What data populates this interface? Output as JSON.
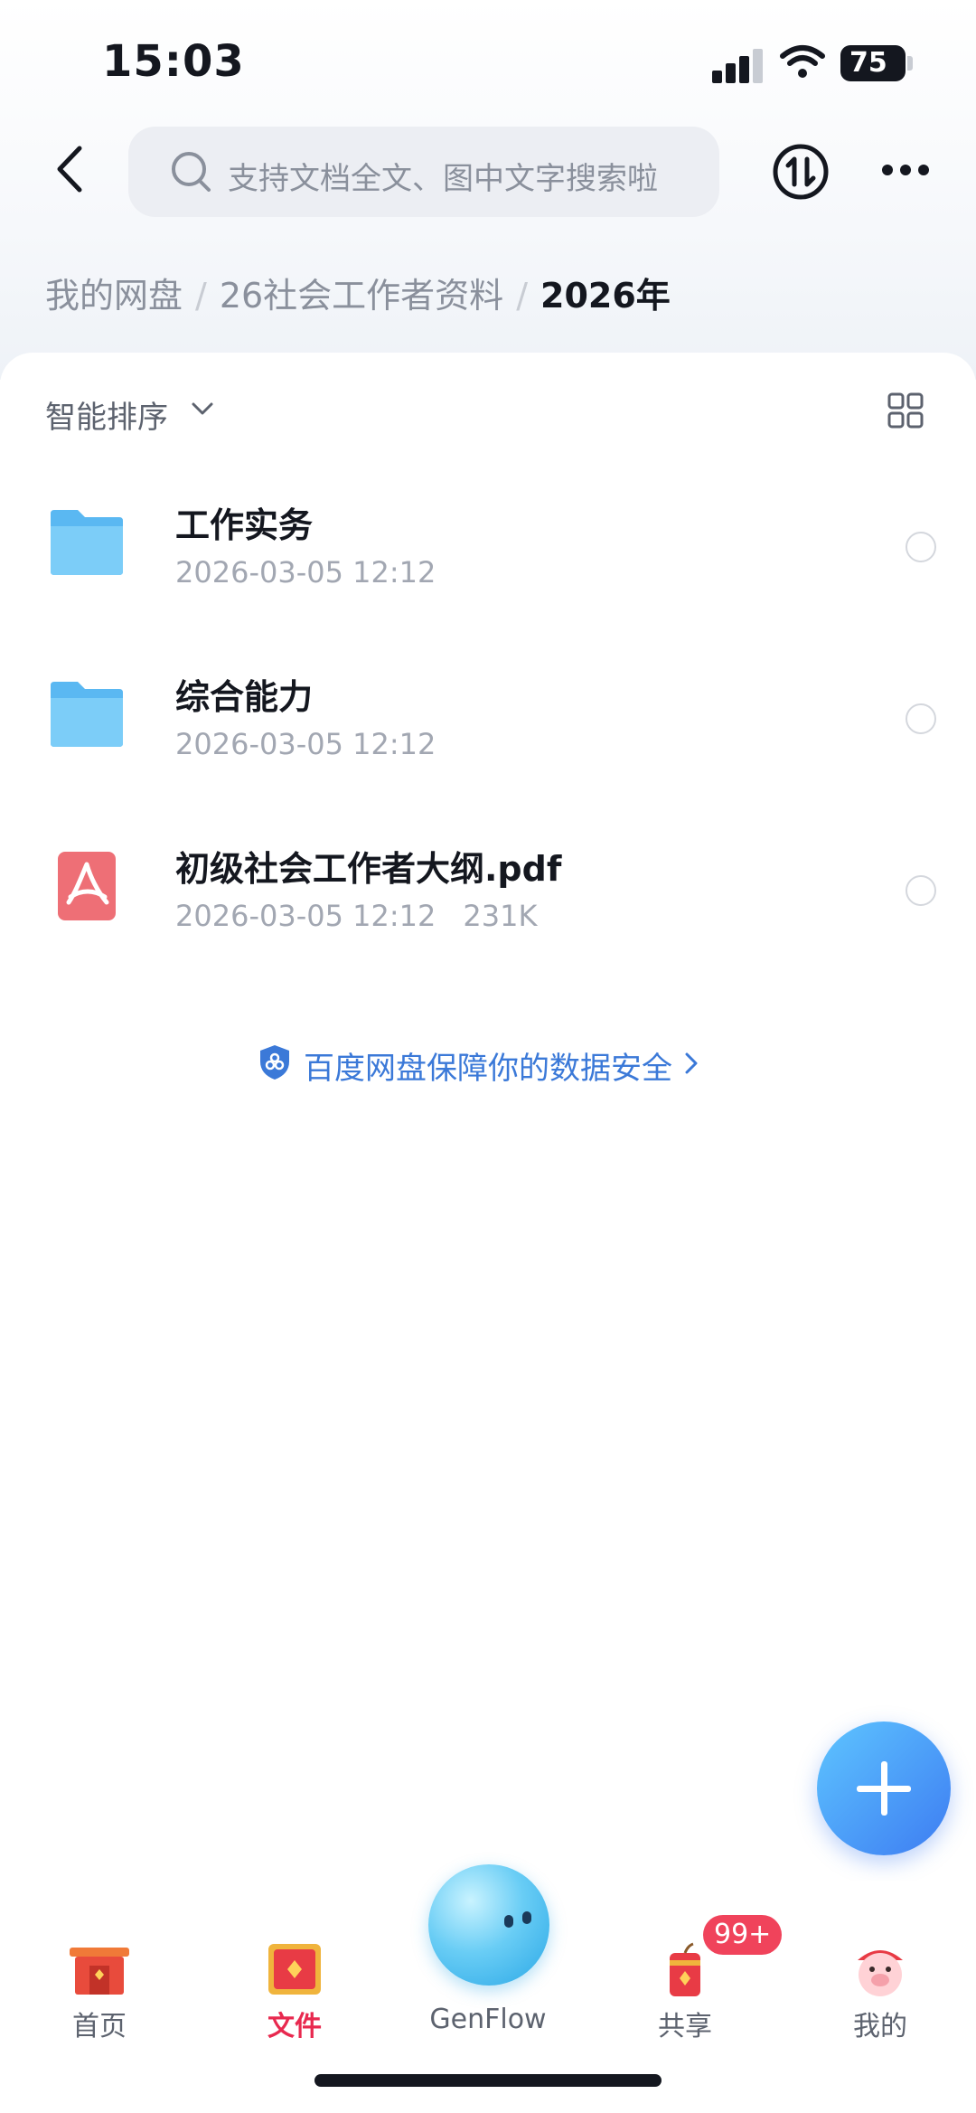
{
  "status_bar": {
    "time": "15:03",
    "battery": "75"
  },
  "header": {
    "search_placeholder": "支持文档全文、图中文字搜索啦"
  },
  "breadcrumb": {
    "root": "我的网盘",
    "parent": "26社会工作者资料",
    "current": "2026年"
  },
  "toolbar": {
    "sort_label": "智能排序"
  },
  "files": [
    {
      "name": "工作实务",
      "date": "2026-03-05 12:12",
      "size": "",
      "type": "folder"
    },
    {
      "name": "综合能力",
      "date": "2026-03-05 12:12",
      "size": "",
      "type": "folder"
    },
    {
      "name": "初级社会工作者大纲.pdf",
      "date": "2026-03-05 12:12",
      "size": "231K",
      "type": "pdf"
    }
  ],
  "safety_notice": "百度网盘保障你的数据安全",
  "tabbar": {
    "tabs": [
      {
        "label": "首页"
      },
      {
        "label": "文件"
      },
      {
        "label": "GenFlow"
      },
      {
        "label": "共享"
      },
      {
        "label": "我的"
      }
    ],
    "share_badge": "99+"
  },
  "colors": {
    "accent": "#3b79d8",
    "active_tab": "#e8294f",
    "folder": "#5ab8f2",
    "pdf": "#ee6f76"
  }
}
